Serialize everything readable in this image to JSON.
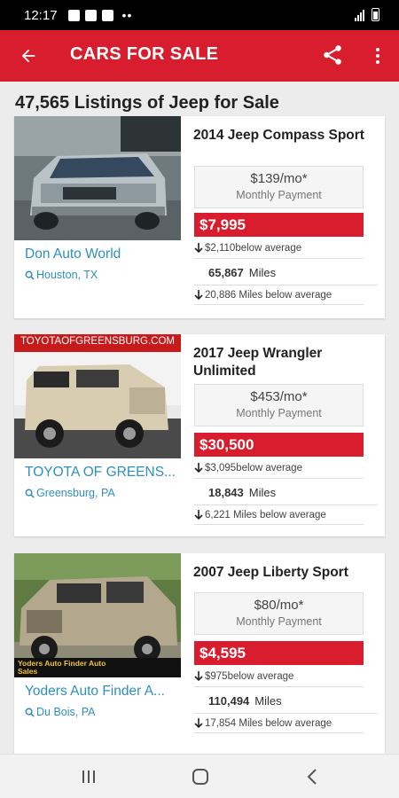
{
  "status": {
    "time": "12:17",
    "extra": "••"
  },
  "app_bar": {
    "title": "CARS FOR SALE"
  },
  "heading": "47,565 Listings of Jeep for Sale",
  "listings": [
    {
      "title": "2014 Jeep Compass Sport",
      "payment": "$139/mo*",
      "payment_label": "Monthly Payment",
      "price": "$7,995",
      "price_delta": "$2,110below average",
      "miles_value": "65,867",
      "miles_unit": "Miles",
      "miles_delta": "20,886 Miles below average",
      "dealer": "Don Auto World",
      "location": "Houston, TX"
    },
    {
      "title": "2017 Jeep Wrangler Unlimited",
      "payment": "$453/mo*",
      "payment_label": "Monthly Payment",
      "price": "$30,500",
      "price_delta": "$3,095below average",
      "miles_value": "18,843",
      "miles_unit": "Miles",
      "miles_delta": "6,221 Miles below average",
      "dealer": "TOYOTA OF GREENS...",
      "location": "Greensburg, PA",
      "photo_banner": "TOYOTAOFGREENSBURG.COM"
    },
    {
      "title": "2007 Jeep Liberty Sport",
      "payment": "$80/mo*",
      "payment_label": "Monthly Payment",
      "price": "$4,595",
      "price_delta": "$975below average",
      "miles_value": "110,494",
      "miles_unit": "Miles",
      "miles_delta": "17,854 Miles below average",
      "dealer": "Yoders Auto Finder A...",
      "location": "Du Bois, PA",
      "photo_banner": "Yoders Auto Finder Auto Sales"
    }
  ],
  "colors": {
    "brand": "#d81e2e",
    "link": "#2e8fbf"
  },
  "icons": {
    "back": "arrow-left-icon",
    "share": "share-icon",
    "more": "more-vert-icon",
    "location": "search-location-icon",
    "down": "arrow-down-icon",
    "nav_recents": "recents-icon",
    "nav_home": "home-icon",
    "nav_back": "chevron-left-icon"
  }
}
